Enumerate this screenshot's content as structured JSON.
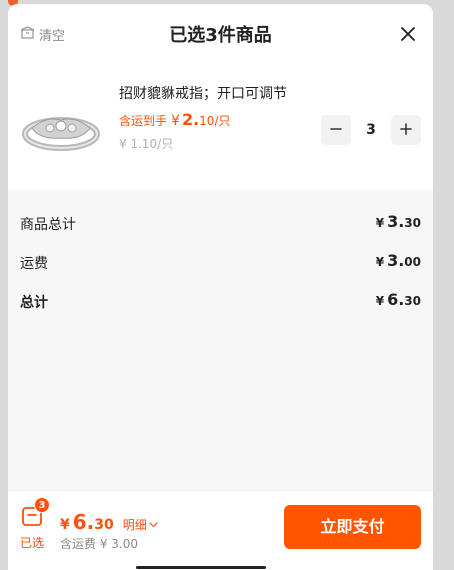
{
  "header": {
    "clear_label": "清空",
    "title": "已选3件商品"
  },
  "product": {
    "name": "招财貔貅戒指；开口可调节",
    "price_label": "含运到手",
    "price_sign": "¥",
    "price_main": "2.",
    "price_unit": "10/只",
    "original_price": "¥ 1.10/只",
    "quantity": "3",
    "thumbnail_icon": "ring-icon"
  },
  "summary": {
    "rows": [
      {
        "label": "商品总计",
        "sign": "¥",
        "int": "3.",
        "dec": "30"
      },
      {
        "label": "运费",
        "sign": "¥",
        "int": "3.",
        "dec": "00"
      },
      {
        "label": "总计",
        "sign": "¥",
        "int": "6.",
        "dec": "30"
      }
    ]
  },
  "footer": {
    "badge_count": "3",
    "selected_label": "已选",
    "total_sign": "¥",
    "total_int": "6.",
    "total_dec": "30",
    "detail_label": "明细",
    "shipping_note": "含运费 ¥ 3.00",
    "pay_label": "立即支付"
  },
  "colors": {
    "accent": "#ff5400",
    "price_text": "#ff4f0a"
  }
}
